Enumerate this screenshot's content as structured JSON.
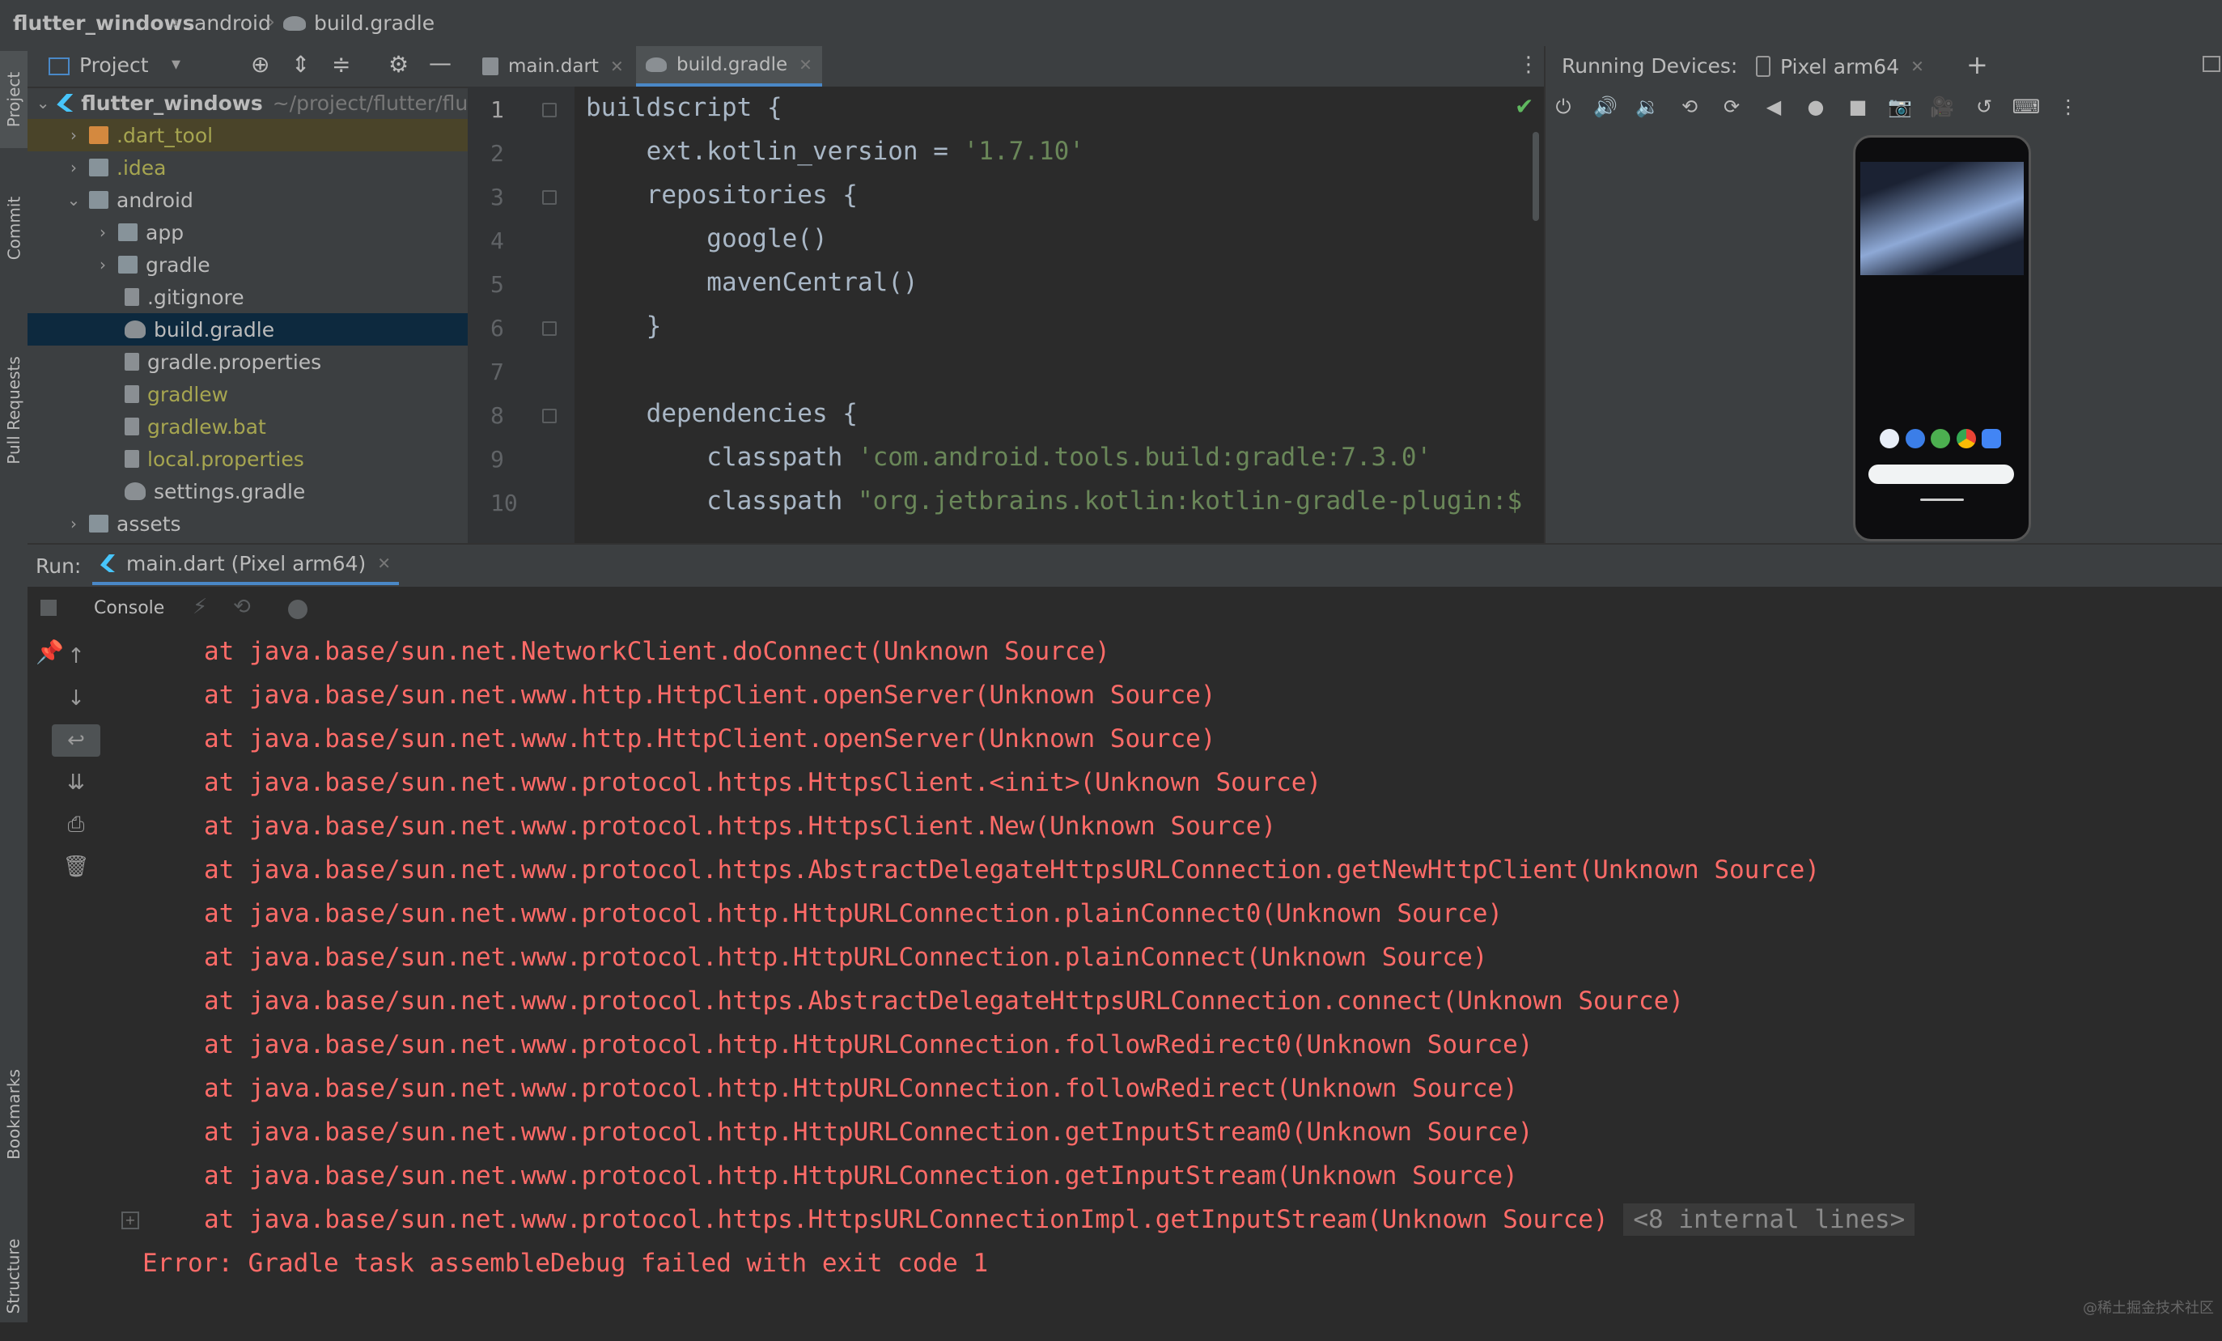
{
  "breadcrumb": {
    "project": "flutter_windows",
    "folder": "android",
    "file": "build.gradle"
  },
  "left_strip": {
    "project": "Project",
    "commit": "Commit",
    "pull_requests": "Pull Requests",
    "bookmarks": "Bookmarks",
    "structure": "Structure"
  },
  "project_panel": {
    "title": "Project",
    "tree": [
      {
        "label": "flutter_windows",
        "path": "~/project/flutter/flut"
      },
      {
        "label": ".dart_tool"
      },
      {
        "label": ".idea"
      },
      {
        "label": "android"
      },
      {
        "label": "app"
      },
      {
        "label": "gradle"
      },
      {
        "label": ".gitignore"
      },
      {
        "label": "build.gradle"
      },
      {
        "label": "gradle.properties"
      },
      {
        "label": "gradlew"
      },
      {
        "label": "gradlew.bat"
      },
      {
        "label": "local.properties"
      },
      {
        "label": "settings.gradle"
      },
      {
        "label": "assets"
      }
    ]
  },
  "editor": {
    "tabs": [
      {
        "label": "main.dart"
      },
      {
        "label": "build.gradle"
      }
    ],
    "line_numbers": [
      "1",
      "2",
      "3",
      "4",
      "5",
      "6",
      "7",
      "8",
      "9",
      "10"
    ],
    "lines": [
      {
        "text": "buildscript {"
      },
      {
        "pre": "    ext.kotlin_version = ",
        "str": "'1.7.10'"
      },
      {
        "text": "    repositories {"
      },
      {
        "text": "        google()"
      },
      {
        "text": "        mavenCentral()"
      },
      {
        "text": "    }"
      },
      {
        "text": ""
      },
      {
        "text": "    dependencies {"
      },
      {
        "pre": "        classpath ",
        "str": "'com.android.tools.build:gradle:7.3.0'"
      },
      {
        "pre": "        classpath ",
        "str": "\"org.jetbrains.kotlin:kotlin-gradle-plugin:$"
      }
    ]
  },
  "devices": {
    "title": "Running Devices:",
    "device_tab": "Pixel arm64"
  },
  "run": {
    "label": "Run:",
    "tab": "main.dart (Pixel arm64)",
    "console_label": "Console"
  },
  "console_lines": [
    "at java.base/sun.net.NetworkClient.doConnect(Unknown Source)",
    "at java.base/sun.net.www.http.HttpClient.openServer(Unknown Source)",
    "at java.base/sun.net.www.http.HttpClient.openServer(Unknown Source)",
    "at java.base/sun.net.www.protocol.https.HttpsClient.<init>(Unknown Source)",
    "at java.base/sun.net.www.protocol.https.HttpsClient.New(Unknown Source)",
    "at java.base/sun.net.www.protocol.https.AbstractDelegateHttpsURLConnection.getNewHttpClient(Unknown Source)",
    "at java.base/sun.net.www.protocol.http.HttpURLConnection.plainConnect0(Unknown Source)",
    "at java.base/sun.net.www.protocol.http.HttpURLConnection.plainConnect(Unknown Source)",
    "at java.base/sun.net.www.protocol.https.AbstractDelegateHttpsURLConnection.connect(Unknown Source)",
    "at java.base/sun.net.www.protocol.http.HttpURLConnection.followRedirect0(Unknown Source)",
    "at java.base/sun.net.www.protocol.http.HttpURLConnection.followRedirect(Unknown Source)",
    "at java.base/sun.net.www.protocol.http.HttpURLConnection.getInputStream0(Unknown Source)",
    "at java.base/sun.net.www.protocol.http.HttpURLConnection.getInputStream(Unknown Source)",
    "at java.base/sun.net.www.protocol.https.HttpsURLConnectionImpl.getInputStream(Unknown Source)"
  ],
  "internal_lines": "<8 internal lines>",
  "error_line": "Error: Gradle task assembleDebug failed with exit code 1",
  "watermark": "@稀土掘金技术社区",
  "colors": {
    "error_text": "#ff6b68",
    "string": "#6a8759",
    "selection": "#0d293e",
    "accent_tab": "#4a88c7"
  }
}
